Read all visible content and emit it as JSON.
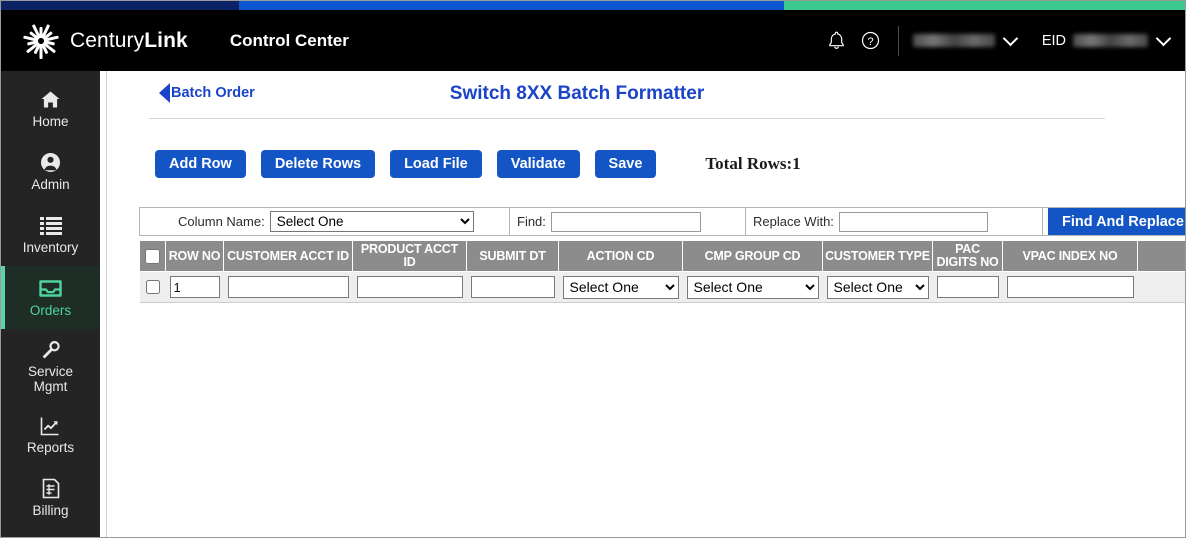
{
  "accent_bar": {
    "navy": "#0b2265",
    "blue": "#0b57d0",
    "green": "#3cc88f"
  },
  "header": {
    "brand_first": "Century",
    "brand_second": "Link",
    "app_name": "Control Center",
    "bell_icon": "notification-bell-icon",
    "help_icon": "help-question-icon",
    "account_name": "",
    "eid_label": "EID",
    "eid_value": ""
  },
  "sidebar": {
    "active": "Orders",
    "items": [
      {
        "label": "Home",
        "icon": "home-icon"
      },
      {
        "label": "Admin",
        "icon": "user-circle-icon"
      },
      {
        "label": "Inventory",
        "icon": "list-icon"
      },
      {
        "label": "Orders",
        "icon": "inbox-icon"
      },
      {
        "label": "Service Mgmt",
        "icon": "wrench-icon",
        "line1": "Service",
        "line2": "Mgmt"
      },
      {
        "label": "Reports",
        "icon": "chart-arrow-icon"
      },
      {
        "label": "Billing",
        "icon": "invoice-icon"
      }
    ]
  },
  "page": {
    "back_label": "Batch Order",
    "title": "Switch 8XX Batch Formatter",
    "accent_color": "#1b44c8"
  },
  "toolbar": {
    "add_row": "Add Row",
    "delete_rows": "Delete Rows",
    "load_file": "Load File",
    "validate": "Validate",
    "save": "Save",
    "total_rows": "Total Rows:1"
  },
  "find_replace": {
    "column_label": "Column Name:",
    "column_value": "Select One",
    "find_label": "Find:",
    "find_value": "",
    "replace_label": "Replace With:",
    "replace_value": "",
    "button_label": "Find And Replace"
  },
  "grid": {
    "columns": [
      {
        "key": "select",
        "label": ""
      },
      {
        "key": "row_no",
        "label": "ROW NO"
      },
      {
        "key": "cust_acct",
        "label": "CUSTOMER ACCT ID"
      },
      {
        "key": "prod_acct",
        "label": "PRODUCT ACCT ID"
      },
      {
        "key": "submit_dt",
        "label": "SUBMIT DT"
      },
      {
        "key": "action_cd",
        "label": "ACTION CD"
      },
      {
        "key": "cmp_group",
        "label": "CMP GROUP CD"
      },
      {
        "key": "cust_type",
        "label": "CUSTOMER TYPE"
      },
      {
        "key": "pac_digits",
        "label": "PAC DIGITS NO"
      },
      {
        "key": "vpac_index",
        "label": "VPAC INDEX NO"
      },
      {
        "key": "extra",
        "label": ""
      }
    ],
    "select_placeholder": "Select One",
    "rows": [
      {
        "checked": false,
        "row_no": "1",
        "cust_acct": "",
        "prod_acct": "",
        "submit_dt": "",
        "action_cd": "Select One",
        "cmp_group": "Select One",
        "cust_type": "Select One",
        "pac_digits": "",
        "vpac_index": "",
        "extra": ""
      }
    ]
  }
}
